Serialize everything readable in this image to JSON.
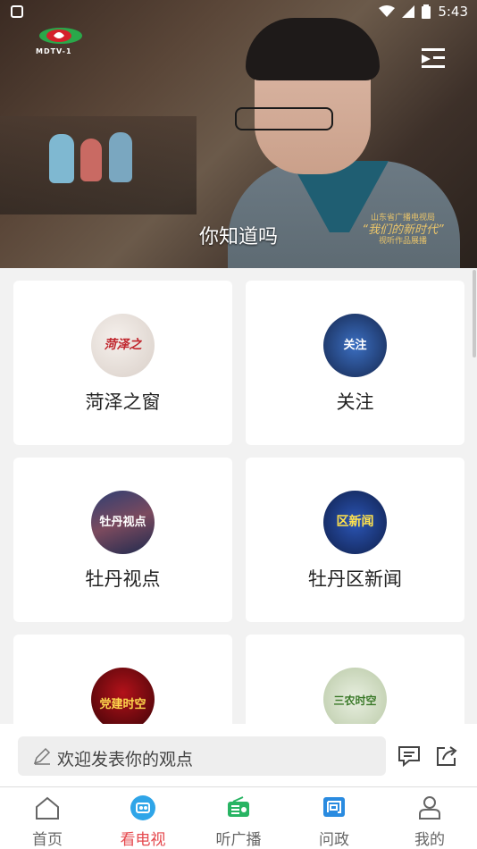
{
  "status_bar": {
    "time": "5:43"
  },
  "header": {
    "logo_text": "MDTV-1"
  },
  "video": {
    "subtitle": "你知道吗",
    "watermark_line1": "山东省广播电视局",
    "watermark_line2": "“我们的新时代”",
    "watermark_line3": "视听作品展播"
  },
  "channels": [
    {
      "label": "菏泽之窗",
      "thumb_text": "菏泽之"
    },
    {
      "label": "关注",
      "thumb_text": "关注"
    },
    {
      "label": "牡丹视点",
      "thumb_text": "牡丹视点"
    },
    {
      "label": "牡丹区新闻",
      "thumb_text": "区新闻"
    },
    {
      "label": "",
      "thumb_text": "党建时空"
    },
    {
      "label": "",
      "thumb_text": "三农时空"
    }
  ],
  "comment": {
    "placeholder": "欢迎发表你的观点"
  },
  "tabs": [
    {
      "label": "首页",
      "icon": "home-icon"
    },
    {
      "label": "看电视",
      "icon": "tv-icon"
    },
    {
      "label": "听广播",
      "icon": "radio-icon"
    },
    {
      "label": "问政",
      "icon": "question-icon"
    },
    {
      "label": "我的",
      "icon": "user-icon"
    }
  ],
  "colors": {
    "accent": "#e5484d",
    "tv_blue": "#2fa5e8",
    "radio_green": "#28b463",
    "ask_blue": "#2a8be0"
  }
}
